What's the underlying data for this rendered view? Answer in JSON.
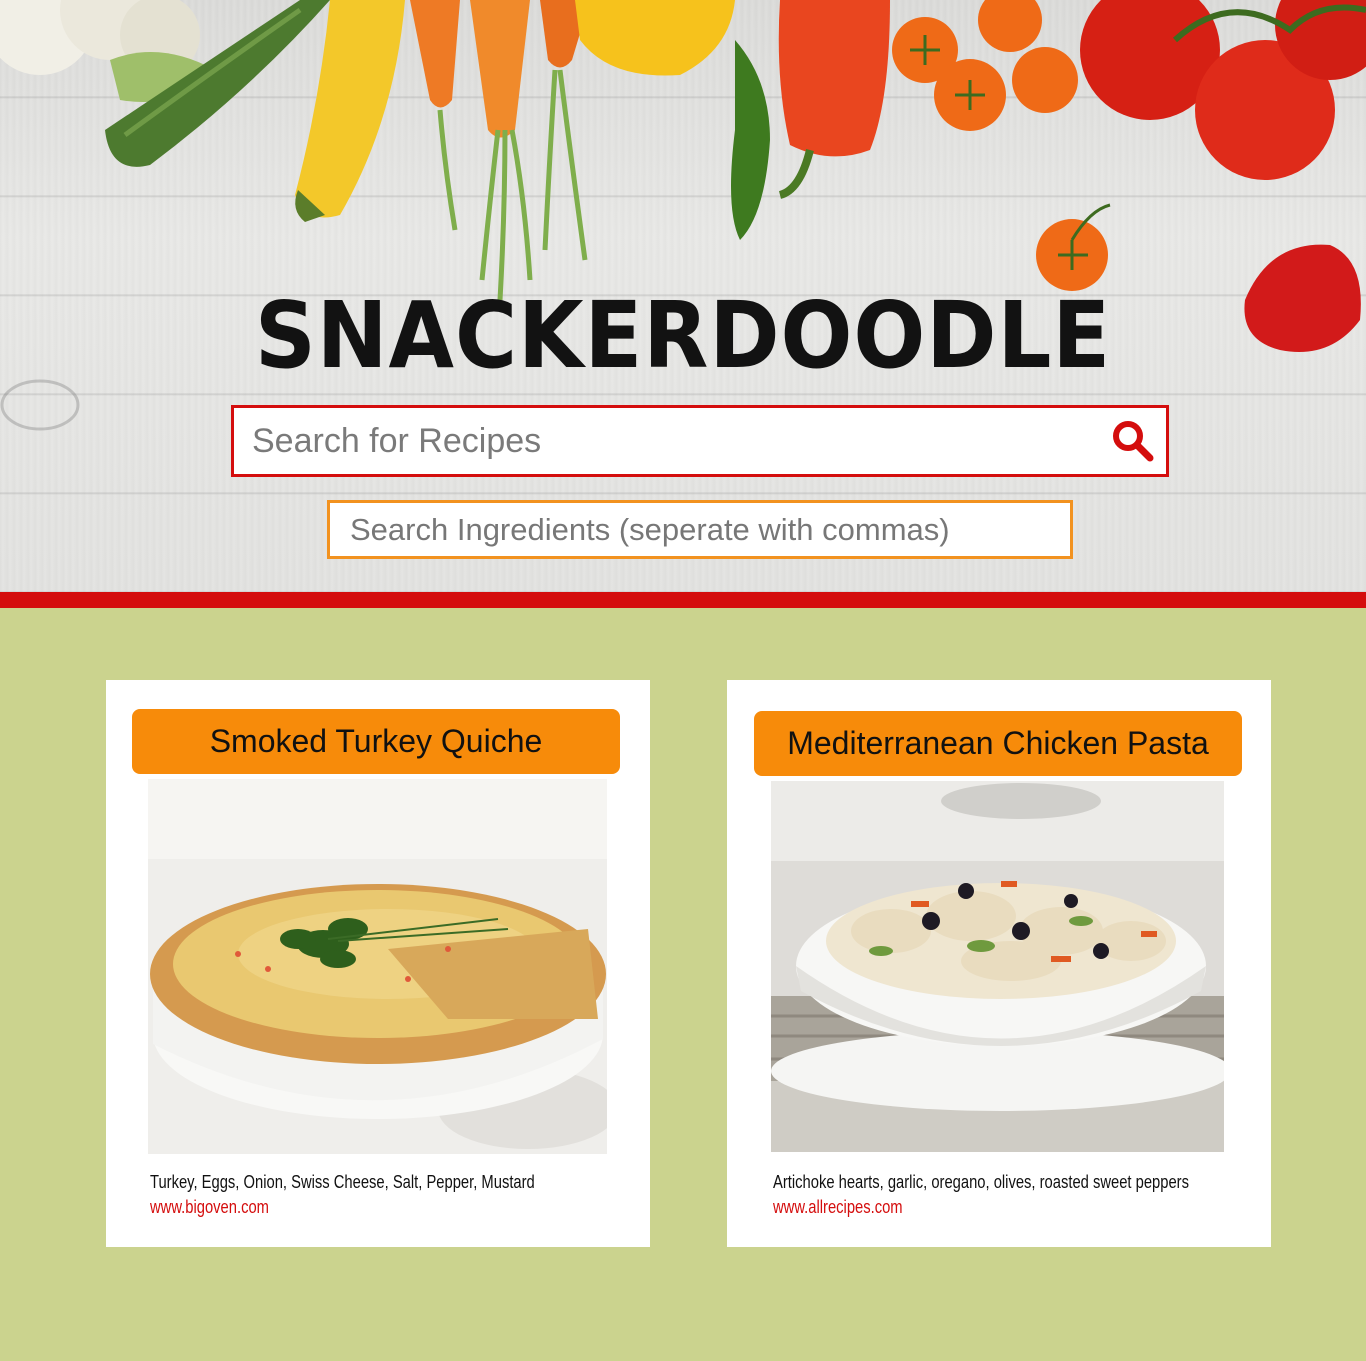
{
  "brand": {
    "name": "SNACKERDOODLE"
  },
  "search": {
    "recipes_placeholder": "Search for Recipes",
    "ingredients_placeholder": "Search Ingredients (seperate with commas)",
    "icon": "search-icon"
  },
  "colors": {
    "accent_red": "#d40d0d",
    "accent_orange": "#f78b0a",
    "page_background": "#cbd38e"
  },
  "recipes": [
    {
      "title": "Smoked Turkey Quiche",
      "ingredients": "Turkey, Eggs, Onion, Swiss Cheese, Salt, Pepper, Mustard",
      "source": "www.bigoven.com"
    },
    {
      "title": "Mediterranean Chicken Pasta",
      "ingredients": "Artichoke hearts, garlic, oregano, olives, roasted sweet peppers",
      "source": "www.allrecipes.com"
    }
  ]
}
